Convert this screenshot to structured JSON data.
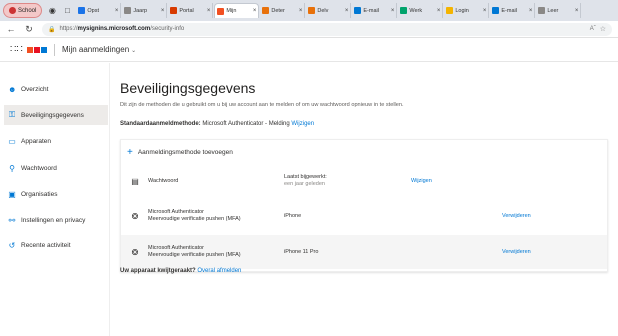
{
  "browser": {
    "profile": "School",
    "tabs": [
      {
        "label": "Opst",
        "color": "#1a73e8",
        "active": false
      },
      {
        "label": "Jaarp",
        "color": "#8a8886",
        "active": false
      },
      {
        "label": "Portal",
        "color": "#d83b01",
        "active": false
      },
      {
        "label": "Mijn",
        "color": "#f25022",
        "active": true
      },
      {
        "label": "Deter",
        "color": "#e8710a",
        "active": false
      },
      {
        "label": "Delv",
        "color": "#e8710a",
        "active": false
      },
      {
        "label": "E-mail",
        "color": "#0078d4",
        "active": false
      },
      {
        "label": "Werk",
        "color": "#00a36c",
        "active": false
      },
      {
        "label": "Login",
        "color": "#f4b400",
        "active": false
      },
      {
        "label": "E-mail",
        "color": "#0078d4",
        "active": false
      },
      {
        "label": "Leer",
        "color": "#8a8886",
        "active": false
      }
    ],
    "url_prefix": "https://",
    "url_host": "mysignins.microsoft.com",
    "url_path": "/security-info"
  },
  "header": {
    "app_title": "Mijn aanmeldingen",
    "logo_colors": [
      "#f25022",
      "#e81123",
      "#0078d4"
    ]
  },
  "nav": {
    "items": [
      {
        "label": "Overzicht",
        "icon": "person-icon"
      },
      {
        "label": "Beveiligingsgegevens",
        "icon": "security-info-icon"
      },
      {
        "label": "Apparaten",
        "icon": "laptop-icon"
      },
      {
        "label": "Wachtwoord",
        "icon": "key-icon"
      },
      {
        "label": "Organisaties",
        "icon": "briefcase-icon"
      },
      {
        "label": "Instellingen en privacy",
        "icon": "lock-icon"
      },
      {
        "label": "Recente activiteit",
        "icon": "history-icon"
      }
    ]
  },
  "main": {
    "title": "Beveiligingsgegevens",
    "subtitle": "Dit zijn de methoden die u gebruikt om u bij uw account aan te melden of om uw wachtwoord opnieuw in te stellen.",
    "default_label": "Standaardaanmeldmethode:",
    "default_value": "Microsoft Authenticator - Melding",
    "default_link": "Wijzigen",
    "add_method": "Aanmeldingsmethode toevoegen",
    "methods": [
      {
        "name1": "Wachtwoord",
        "name2": "",
        "detail1": "Laatst bijgewerkt:",
        "detail2": "een jaar geleden",
        "action": "Wijzigen",
        "icon": "password-icon"
      },
      {
        "name1": "Microsoft Authenticator",
        "name2": "Meervoudige verificatie pushen (MFA)",
        "detail1": "iPhone",
        "detail2": "",
        "action": "Verwijderen",
        "icon": "authenticator-icon"
      },
      {
        "name1": "Microsoft Authenticator",
        "name2": "Meervoudige verificatie pushen (MFA)",
        "detail1": "iPhone 11 Pro",
        "detail2": "",
        "action": "Verwijderen",
        "icon": "authenticator-icon"
      }
    ],
    "lost_label": "Uw apparaat kwijtgeraakt?",
    "lost_link": "Overal afmelden"
  }
}
